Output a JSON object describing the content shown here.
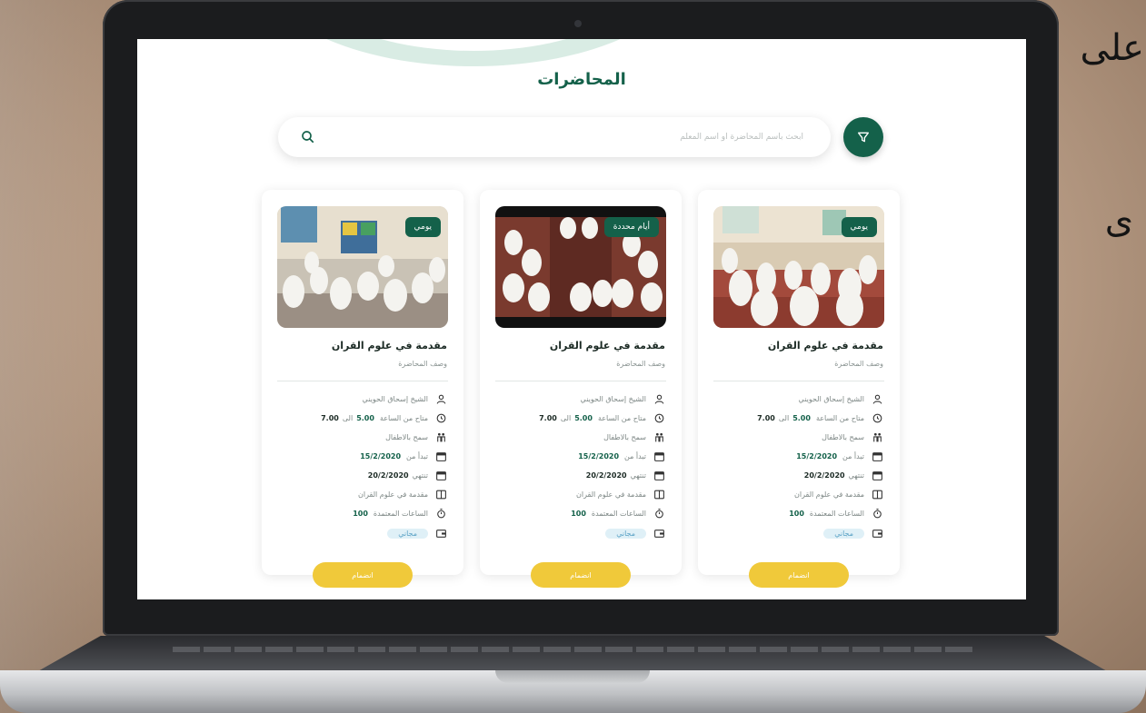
{
  "background_text": [
    "على",
    "ى"
  ],
  "page": {
    "title": "المحاضرات",
    "search_placeholder": "ابحث باسم المحاضرة أو اسم المعلم"
  },
  "colors": {
    "primary": "#14614a",
    "accent": "#f0c93a",
    "free_badge": "#dff0f7"
  },
  "cards": [
    {
      "badge": "يومي",
      "title": "مقدمة في علوم القران",
      "desc": "وصف المحاضرة",
      "teacher": "الشيخ إسحاق الحويني",
      "time_label": "متاح من الساعة",
      "time_from": "5.00",
      "time_sep": "الى",
      "time_to": "7.00",
      "kids": "سمح بالاطفال",
      "start_label": "تبدأ من",
      "start_date": "15/2/2020",
      "end_label": "تنتهي",
      "end_date": "20/2/2020",
      "course": "مقدمة في علوم القران",
      "hours_label": "الساعات المعتمدة",
      "hours": "100",
      "price": "مجاني",
      "join": "انضمام"
    },
    {
      "badge": "أيام محددة",
      "title": "مقدمة في علوم القران",
      "desc": "وصف المحاضرة",
      "teacher": "الشيخ إسحاق الحويني",
      "time_label": "متاح من الساعة",
      "time_from": "5.00",
      "time_sep": "الى",
      "time_to": "7.00",
      "kids": "سمح بالاطفال",
      "start_label": "تبدأ من",
      "start_date": "15/2/2020",
      "end_label": "تنتهي",
      "end_date": "20/2/2020",
      "course": "مقدمة في علوم القران",
      "hours_label": "الساعات المعتمدة",
      "hours": "100",
      "price": "مجاني",
      "join": "انضمام"
    },
    {
      "badge": "يومي",
      "title": "مقدمة في علوم القران",
      "desc": "وصف المحاضرة",
      "teacher": "الشيخ إسحاق الحويني",
      "time_label": "متاح من الساعة",
      "time_from": "5.00",
      "time_sep": "الى",
      "time_to": "7.00",
      "kids": "سمح بالاطفال",
      "start_label": "تبدأ من",
      "start_date": "15/2/2020",
      "end_label": "تنتهي",
      "end_date": "20/2/2020",
      "course": "مقدمة في علوم القران",
      "hours_label": "الساعات المعتمدة",
      "hours": "100",
      "price": "مجاني",
      "join": "انضمام"
    }
  ]
}
